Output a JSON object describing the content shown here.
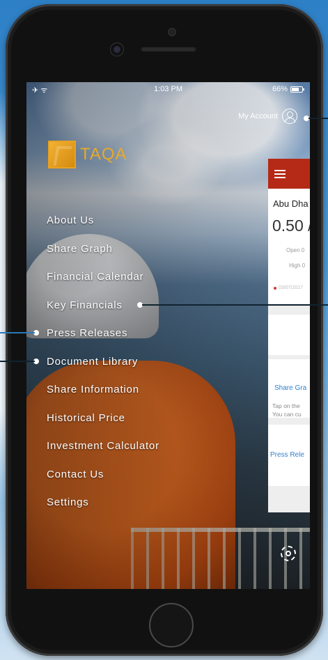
{
  "status_bar": {
    "time": "1:03 PM",
    "battery": "66%",
    "left_icons": "✈ ᯤ"
  },
  "header": {
    "account_label": "My Account"
  },
  "logo": {
    "text": "TAQA"
  },
  "menu": {
    "items": [
      {
        "label": "About Us"
      },
      {
        "label": "Share Graph"
      },
      {
        "label": "Financial Calendar"
      },
      {
        "label": "Key Financials"
      },
      {
        "label": "Press Releases"
      },
      {
        "label": "Document Library"
      },
      {
        "label": "Share Information"
      },
      {
        "label": "Historical Price"
      },
      {
        "label": "Investment Calculator"
      },
      {
        "label": "Contact Us"
      },
      {
        "label": "Settings"
      }
    ]
  },
  "panel": {
    "title": "Abu Dha",
    "price": "0.50 /",
    "open_label": "Open 0",
    "high_label": "High 0",
    "date": "03/07/2017",
    "tap_line1": "Tap on the",
    "tap_line2": "You can cu",
    "share_graph_link": "Share Gra",
    "press_releases_link": "Press Rele"
  },
  "colors": {
    "brand_gold": "#e8a92a",
    "header_red": "#b52a16",
    "link_blue": "#2e7fd0"
  }
}
